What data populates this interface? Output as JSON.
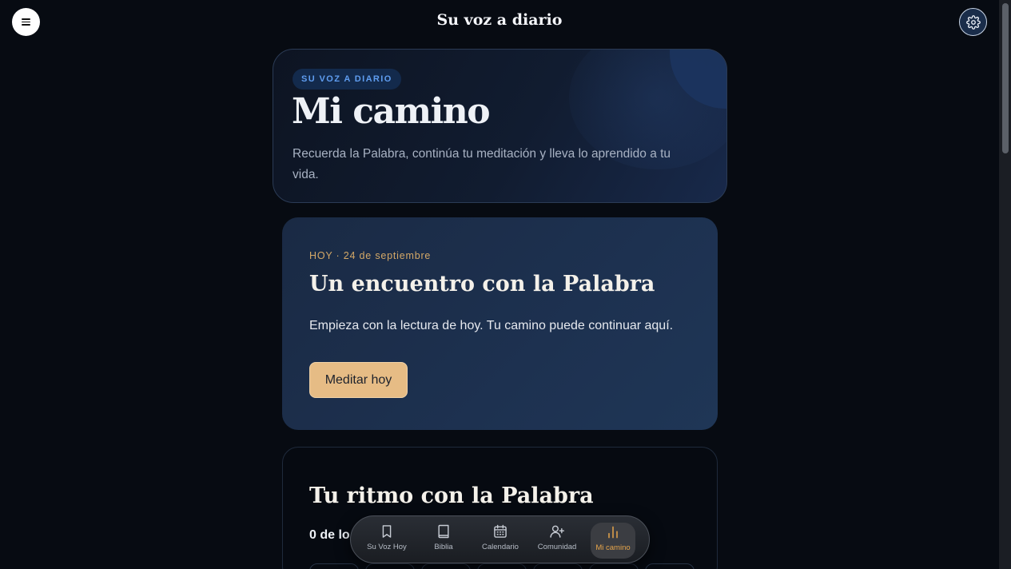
{
  "header": {
    "title": "Su voz a diario",
    "menu_icon": "menu-icon",
    "settings_icon": "gear-icon"
  },
  "hero": {
    "badge": "SU VOZ A DIARIO",
    "title": "Mi camino",
    "description": "Recuerda la Palabra, continúa tu meditación y lleva lo aprendido a tu vida."
  },
  "today": {
    "date": "HOY · 24 de septiembre",
    "title": "Un encuentro con la Palabra",
    "description": "Empieza con la lectura de hoy. Tu camino puede continuar aquí.",
    "button_label": "Meditar hoy"
  },
  "rhythm": {
    "title": "Tu ritmo con la Palabra",
    "count_text": "0 de lo"
  },
  "bottom_nav": {
    "items": [
      {
        "label": "Su Voz Hoy",
        "icon": "bookmark-icon",
        "active": false
      },
      {
        "label": "Biblia",
        "icon": "book-icon",
        "active": false
      },
      {
        "label": "Calendario",
        "icon": "calendar-icon",
        "active": false
      },
      {
        "label": "Comunidad",
        "icon": "user-plus-icon",
        "active": false
      },
      {
        "label": "Mi camino",
        "icon": "bar-chart-icon",
        "active": true
      }
    ]
  },
  "colors": {
    "accent_gold": "#e6bc85",
    "active_nav": "#e6a54b",
    "badge_blue": "#5f9df0",
    "background": "#070b12"
  }
}
